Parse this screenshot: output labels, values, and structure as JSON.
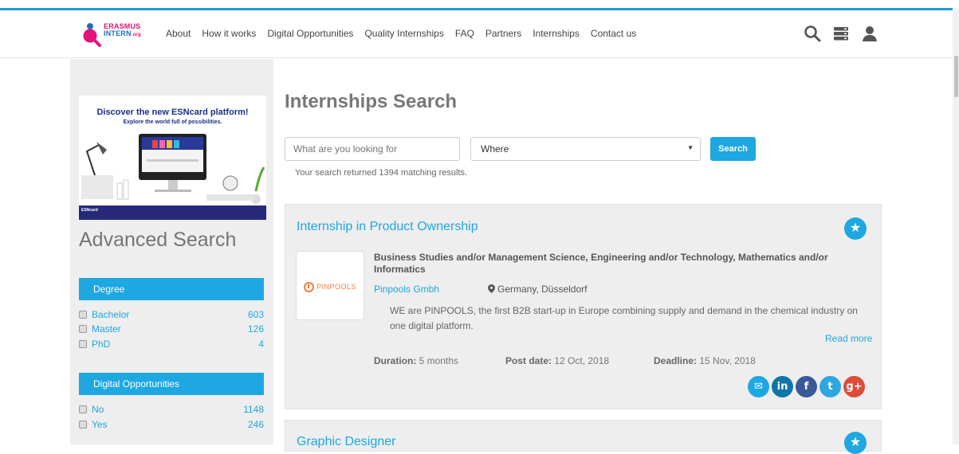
{
  "header": {
    "logo": {
      "line1": "ERASMUS",
      "line2": "INTERN",
      "suffix": ".org"
    },
    "nav": [
      "About",
      "How it works",
      "Digital Opportunities",
      "Quality Internships",
      "FAQ",
      "Partners",
      "Internships",
      "Contact us"
    ],
    "icons": [
      "search-icon",
      "menu-stack-icon",
      "user-icon"
    ]
  },
  "sidebar": {
    "banner": {
      "title": "Discover the new ESNcard platform!",
      "subtitle": "Explore the world full of possibilities.",
      "footer": "ESNcard"
    },
    "advanced_title": "Advanced Search",
    "facets": [
      {
        "title": "Degree",
        "options": [
          {
            "label": "Bachelor",
            "count": "603"
          },
          {
            "label": "Master",
            "count": "126"
          },
          {
            "label": "PhD",
            "count": "4"
          }
        ]
      },
      {
        "title": "Digital Opportunities",
        "options": [
          {
            "label": "No",
            "count": "1148"
          },
          {
            "label": "Yes",
            "count": "246"
          }
        ]
      }
    ]
  },
  "main": {
    "title": "Internships Search",
    "search_placeholder": "What are you looking for",
    "where_value": "Where",
    "search_button": "Search",
    "results_text": "Your search returned 1394 matching results.",
    "listings": [
      {
        "title": "Internship in Product Ownership",
        "subject": "Business Studies and/or Management Science, Engineering and/or Technology, Mathematics and/or Informatics",
        "company": "Pinpools Gmbh",
        "company_logo_text": "PINPOOLS",
        "location": "Germany, Düsseldorf",
        "description": "WE are PINPOOLS, the first B2B start-up in Europe combining supply and demand in the chemical industry on one digital platform.",
        "read_more": "Read more",
        "duration_label": "Duration:",
        "duration": "5 months",
        "post_label": "Post date:",
        "post_date": "12 Oct, 2018",
        "deadline_label": "Deadline:",
        "deadline": "15 Nov, 2018",
        "share": [
          {
            "name": "email-share-icon",
            "glyph": "✉",
            "color": "#1ea7e1"
          },
          {
            "name": "linkedin-share-icon",
            "glyph": "in",
            "color": "#0e76a8"
          },
          {
            "name": "facebook-share-icon",
            "glyph": "f",
            "color": "#3b5998"
          },
          {
            "name": "twitter-share-icon",
            "glyph": "t",
            "color": "#2ea7e0"
          },
          {
            "name": "googleplus-share-icon",
            "glyph": "g+",
            "color": "#dd4b39"
          }
        ]
      },
      {
        "title": "Graphic Designer"
      }
    ]
  },
  "colors": {
    "accent": "#1ea7e1",
    "brand_pink": "#e2137b",
    "brand_blue": "#1f6fb6"
  }
}
